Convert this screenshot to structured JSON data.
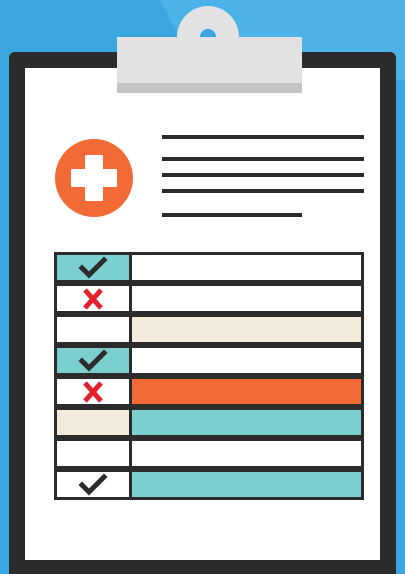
{
  "colors": {
    "background": "#3aa6df",
    "background_shade": "#4db3e6",
    "board": "#2b2b2b",
    "paper": "#ffffff",
    "clip": "#e2e2e4",
    "clip_shadow": "#c4c4c6",
    "medical_icon": "#f26a35",
    "teal": "#7ccfcf",
    "cream": "#f3ebdb",
    "orange": "#f26a35",
    "check": "#2b2b2b",
    "cross": "#e4202a"
  },
  "checklist": {
    "rows": [
      {
        "status_icon": "check-icon",
        "status_fill": "teal",
        "content_fill": "white"
      },
      {
        "status_icon": "cross-icon",
        "status_fill": "white",
        "content_fill": "white"
      },
      {
        "status_icon": "none",
        "status_fill": "white",
        "content_fill": "cream"
      },
      {
        "status_icon": "check-icon",
        "status_fill": "teal",
        "content_fill": "white"
      },
      {
        "status_icon": "cross-icon",
        "status_fill": "white",
        "content_fill": "orange"
      },
      {
        "status_icon": "none",
        "status_fill": "cream",
        "content_fill": "teal"
      },
      {
        "status_icon": "none",
        "status_fill": "white",
        "content_fill": "white"
      },
      {
        "status_icon": "check-icon",
        "status_fill": "white",
        "content_fill": "teal"
      }
    ]
  }
}
